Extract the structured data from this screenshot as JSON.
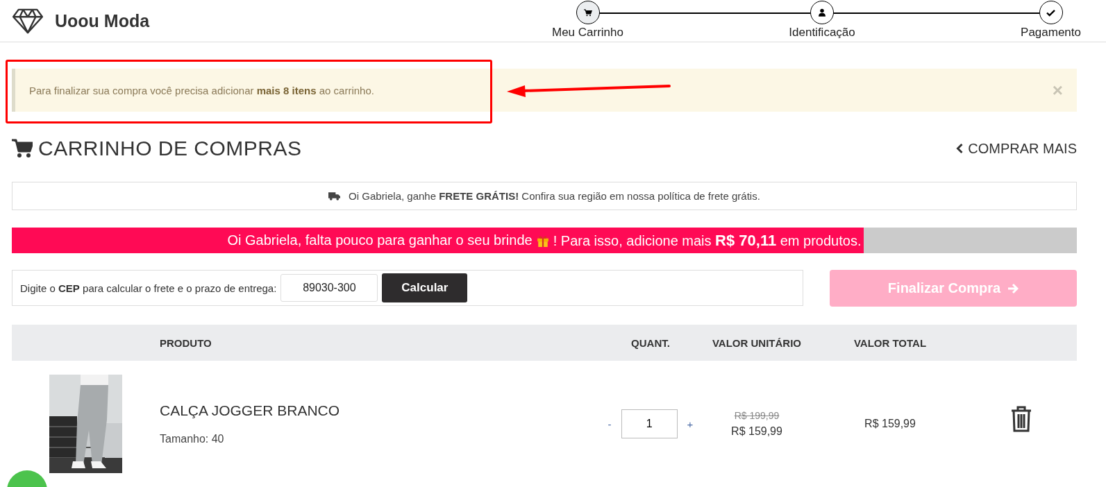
{
  "header": {
    "brand": "Uoou Moda"
  },
  "steps": [
    {
      "label": "Meu Carrinho",
      "kind": "cart",
      "selected": true
    },
    {
      "label": "Identificação",
      "kind": "user",
      "selected": false
    },
    {
      "label": "Pagamento",
      "kind": "check",
      "selected": false
    }
  ],
  "alert": {
    "text": "Para finalizar sua compra você precisa adicionar **mais 8 itens** ao carrinho.",
    "close": "×"
  },
  "page_title": "CARRINHO DE COMPRAS",
  "continue_link": "COMPRAR MAIS",
  "shipping_notice": "Oi Gabriela, ganhe **FRETE GRÁTIS!** Confira sua região em nossa política de frete grátis.",
  "gift_progress": {
    "text_before": "Oi Gabriela, falta pouco para ganhar o seu brinde",
    "text_after": "! Para isso, adicione mais **R$ 70,11** em produtos.",
    "level": 0.8
  },
  "cep": {
    "label": "Digite o **CEP** para calcular o frete e o prazo de entrega:",
    "value": "89030-300",
    "button": "Calcular"
  },
  "checkout_button": {
    "label": "Finalizar Compra",
    "disabled": true
  },
  "table": {
    "columns": [
      "PRODUTO",
      "QUANT.",
      "VALOR UNITÁRIO",
      "VALOR TOTAL"
    ],
    "rows": [
      {
        "kind": "picture",
        "name": "CALÇA JOGGER BRANCO",
        "size": "Tamanho: 40",
        "minus": "-",
        "quantity": "1",
        "plus": "+",
        "old_price": "R$ 199,99",
        "price": "R$ 159,99",
        "total": "R$ 159,99"
      }
    ]
  }
}
